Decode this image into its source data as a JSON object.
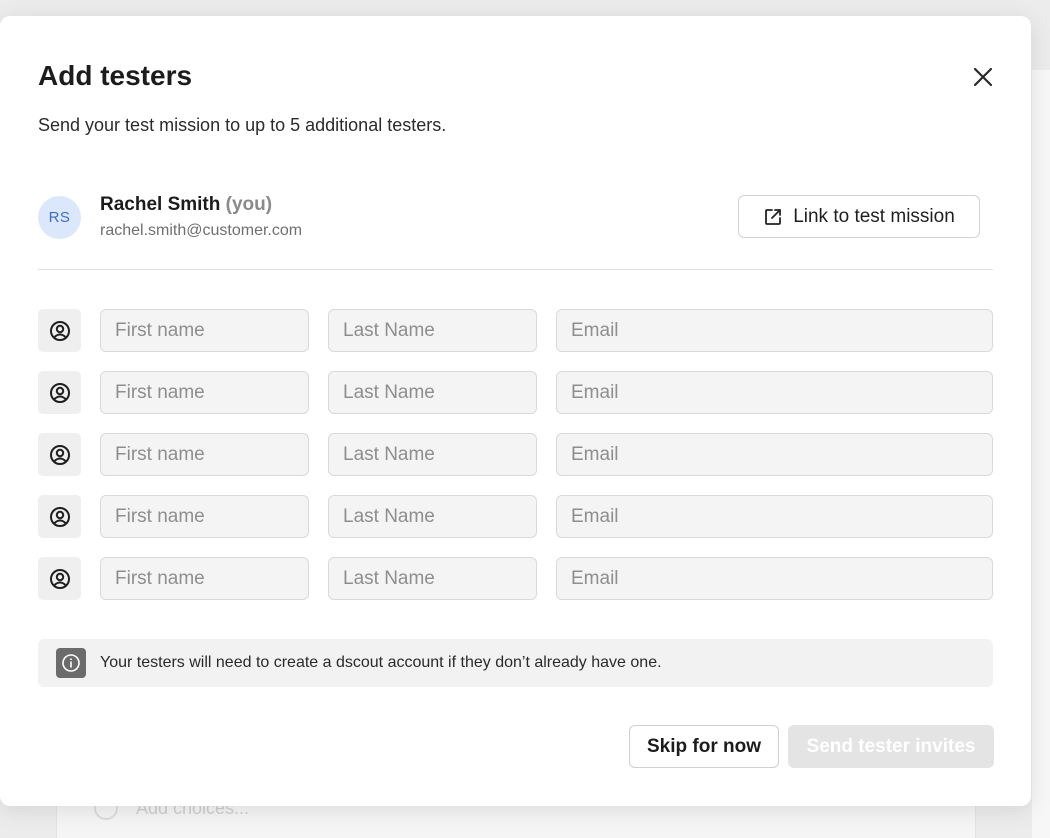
{
  "background": {
    "choice_placeholder": "Add choices..."
  },
  "modal": {
    "title": "Add testers",
    "subtitle": "Send your test mission to up to 5 additional testers.",
    "close_icon": "close-icon"
  },
  "current_user": {
    "initials": "RS",
    "name": "Rachel Smith",
    "you_label": "(you)",
    "email": "rachel.smith@customer.com",
    "avatar_bg": "#dbe8fb",
    "avatar_fg": "#3c6fc2"
  },
  "link_button": {
    "label": "Link to test mission",
    "icon": "external-link-icon"
  },
  "tester_rows": [
    {
      "icon": "user-circle-icon",
      "first_placeholder": "First name",
      "last_placeholder": "Last Name",
      "email_placeholder": "Email"
    },
    {
      "icon": "user-circle-icon",
      "first_placeholder": "First name",
      "last_placeholder": "Last Name",
      "email_placeholder": "Email"
    },
    {
      "icon": "user-circle-icon",
      "first_placeholder": "First name",
      "last_placeholder": "Last Name",
      "email_placeholder": "Email"
    },
    {
      "icon": "user-circle-icon",
      "first_placeholder": "First name",
      "last_placeholder": "Last Name",
      "email_placeholder": "Email"
    },
    {
      "icon": "user-circle-icon",
      "first_placeholder": "First name",
      "last_placeholder": "Last Name",
      "email_placeholder": "Email"
    }
  ],
  "info_notice": {
    "icon": "info-icon",
    "text": "Your testers will need to create a dscout account if they don’t already have one."
  },
  "footer": {
    "skip_label": "Skip for now",
    "send_label": "Send tester invites",
    "send_disabled": true
  }
}
